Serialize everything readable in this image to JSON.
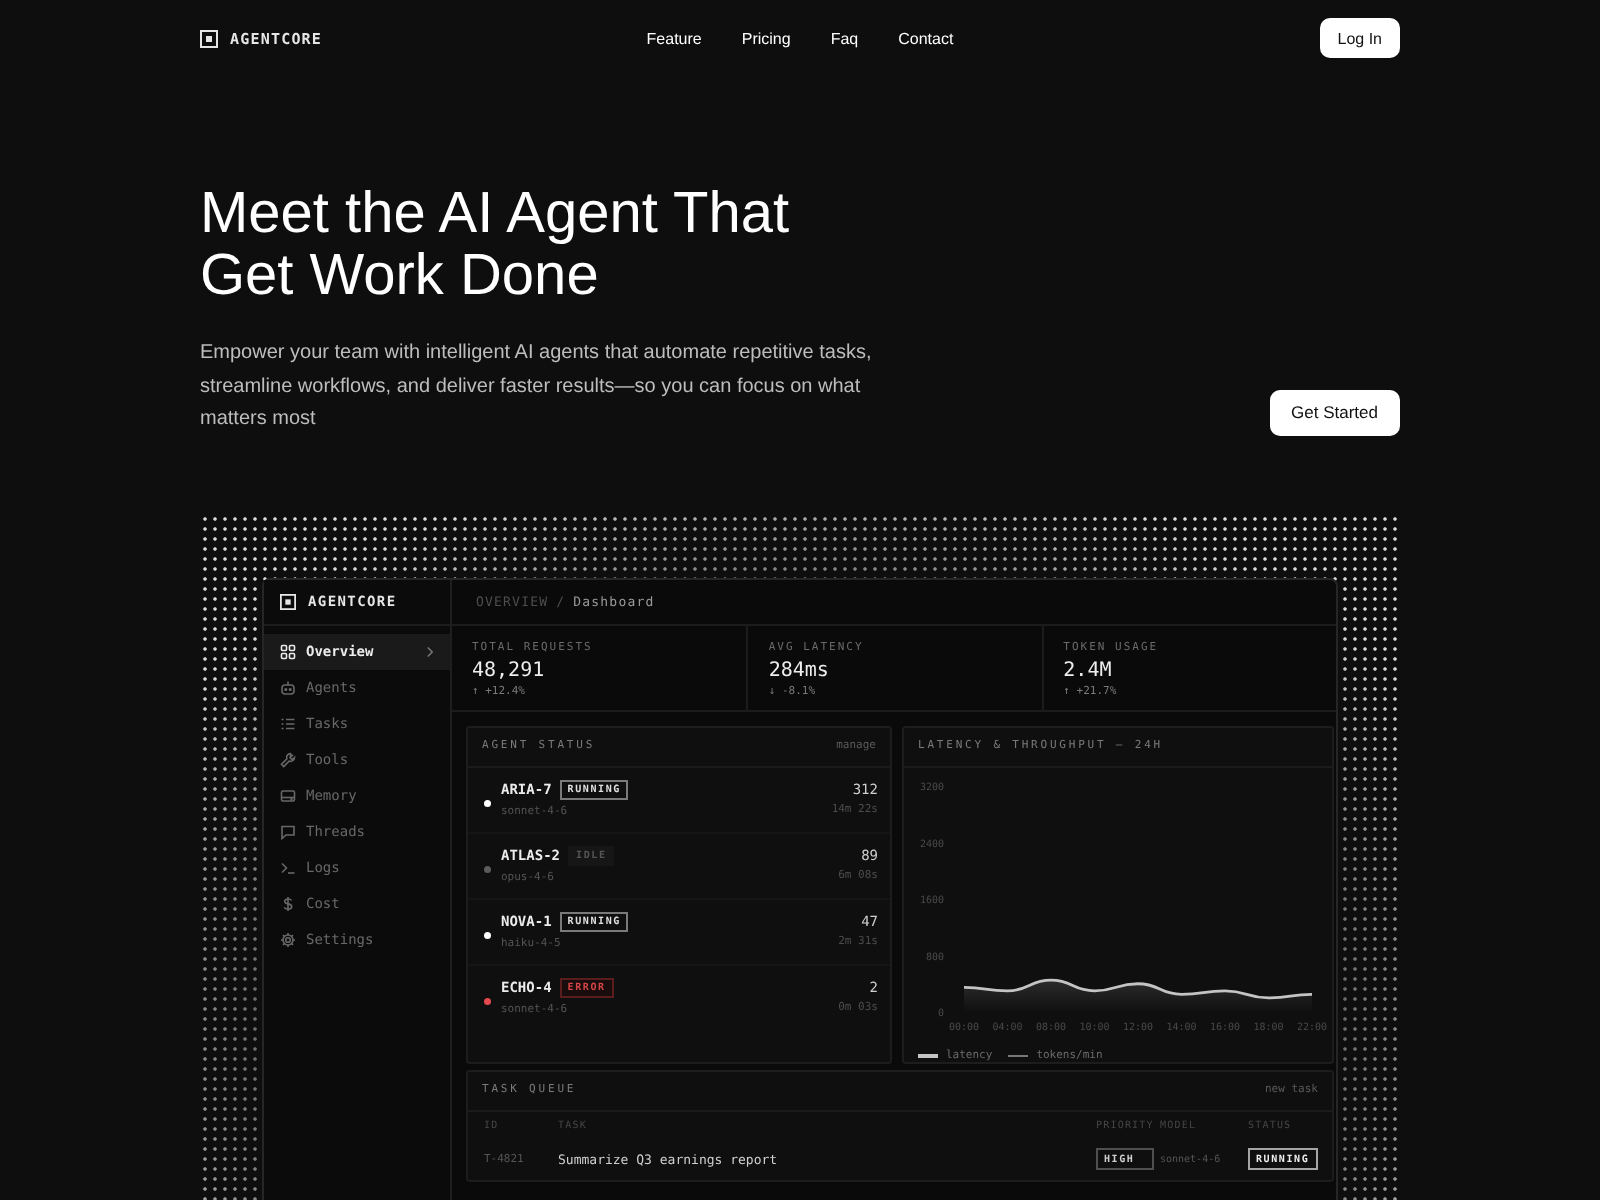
{
  "header": {
    "logo": "AGENTCORE",
    "nav": [
      "Feature",
      "Pricing",
      "Faq",
      "Contact"
    ],
    "login": "Log In"
  },
  "hero": {
    "title": "Meet the AI Agent That Get Work Done",
    "text": "Empower your team with intelligent AI agents that automate repetitive tasks, streamline workflows, and deliver faster results—so you can focus on what matters most",
    "cta": "Get Started"
  },
  "dashboard": {
    "logo": "AGENTCORE",
    "breadcrumb": {
      "section": "OVERVIEW",
      "separator": "/",
      "page": "Dashboard"
    },
    "sidebar": {
      "items": [
        {
          "label": "Overview",
          "selected": true
        },
        {
          "label": "Agents",
          "selected": false
        },
        {
          "label": "Tasks",
          "selected": false
        },
        {
          "label": "Tools",
          "selected": false
        },
        {
          "label": "Memory",
          "selected": false
        },
        {
          "label": "Threads",
          "selected": false
        },
        {
          "label": "Logs",
          "selected": false
        },
        {
          "label": "Cost",
          "selected": false
        },
        {
          "label": "Settings",
          "selected": false
        }
      ]
    },
    "stats": [
      {
        "label": "TOTAL REQUESTS",
        "value": "48,291",
        "delta": "↑ +12.4%"
      },
      {
        "label": "AVG LATENCY",
        "value": "284ms",
        "delta": "↓ -8.1%"
      },
      {
        "label": "TOKEN USAGE",
        "value": "2.4M",
        "delta": "↑ +21.7%"
      }
    ],
    "agent_status": {
      "title": "AGENT STATUS",
      "action": "manage",
      "agents": [
        {
          "name": "ARIA-7",
          "status": "RUNNING",
          "kind": "running",
          "color": "#ffffff",
          "model": "sonnet-4-6",
          "count": "312",
          "time": "14m 22s"
        },
        {
          "name": "ATLAS-2",
          "status": "IDLE",
          "kind": "idle",
          "color": "#5c5c5c",
          "model": "opus-4-6",
          "count": "89",
          "time": "6m 08s"
        },
        {
          "name": "NOVA-1",
          "status": "RUNNING",
          "kind": "running",
          "color": "#ffffff",
          "model": "haiku-4-5",
          "count": "47",
          "time": "2m 31s"
        },
        {
          "name": "ECHO-4",
          "status": "ERROR",
          "kind": "error",
          "color": "#e5484d",
          "model": "sonnet-4-6",
          "count": "2",
          "time": "0m 03s"
        }
      ]
    },
    "chart": {
      "title": "LATENCY & THROUGHPUT — 24H",
      "chart_data": {
        "type": "area",
        "categories": [
          "00:00",
          "04:00",
          "08:00",
          "10:00",
          "12:00",
          "14:00",
          "16:00",
          "18:00",
          "22:00"
        ],
        "series": [
          {
            "name": "latency",
            "color": "#c4c4c4",
            "values": [
              350,
              300,
              450,
              300,
              400,
              250,
              300,
              200,
              250
            ]
          },
          {
            "name": "tokens/min",
            "color": "#777777",
            "values": [
              null,
              null,
              null,
              null,
              null,
              null,
              null,
              null,
              null
            ]
          }
        ],
        "ylim": [
          0,
          3200
        ],
        "yticks": [
          0,
          800,
          1600,
          2400,
          3200
        ]
      }
    },
    "task_queue": {
      "title": "TASK QUEUE",
      "action": "new task",
      "columns": [
        "ID",
        "TASK",
        "PRIORITY",
        "MODEL",
        "STATUS"
      ],
      "rows": [
        {
          "id": "T-4821",
          "task": "Summarize Q3 earnings report",
          "priority": "HIGH",
          "model": "sonnet-4-6",
          "status": "RUNNING"
        }
      ]
    }
  }
}
